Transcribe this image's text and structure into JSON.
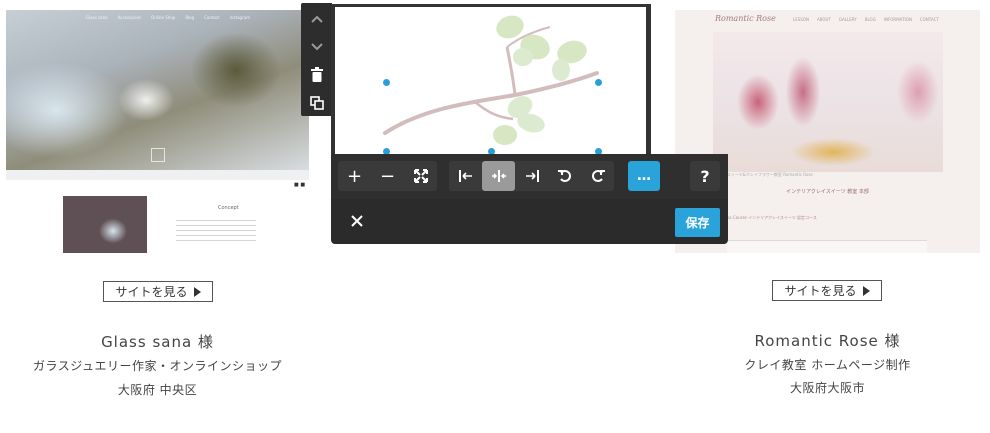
{
  "left_card": {
    "nav_items": [
      "Glass sana",
      "Accessories",
      "Online Shop",
      "Blog",
      "Contact",
      "Instagram"
    ],
    "concept_label": "Concept",
    "view_button": "サイトを見る",
    "title": "Glass sana 様",
    "subtitle": "ガラスジュエリー作家・オンラインショップ",
    "location": "大阪府 中央区"
  },
  "right_card": {
    "logo_text": "Romantic Rose",
    "nav_items": [
      "LESSON",
      "ABOUT",
      "GALLERY",
      "BLOG",
      "INFORMATION",
      "CONTACT"
    ],
    "hero_caption": "クレイスイーツ&クレイフラワー教室 Romantic Rose",
    "heading": "インテリアクレイスイーツ 教室 本部",
    "subheading": "Diploma Course インテリアクレイスイーツ 認定コース",
    "view_button": "サイトを見る",
    "title": "Romantic Rose 様",
    "subtitle": "クレイ教室 ホームページ制作",
    "location": "大阪府大阪市"
  },
  "editor": {
    "side_actions": [
      "move-up",
      "move-down",
      "delete",
      "duplicate"
    ],
    "zoom_in": "+",
    "zoom_out": "−",
    "more_label": "…",
    "help_label": "?",
    "save_label": "保存",
    "colors": {
      "accent": "#2aa3db",
      "toolbar": "#2f2f2f",
      "active": "#9a9a9a"
    }
  }
}
